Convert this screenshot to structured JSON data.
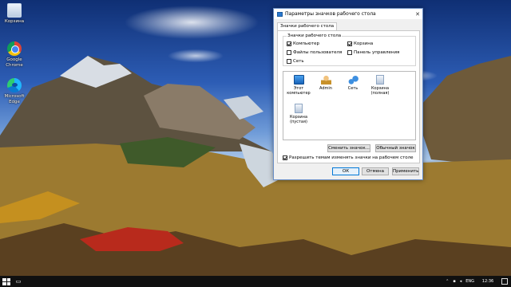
{
  "desktop": {
    "icons": [
      {
        "label": "Корзина",
        "icon": "recycle-bin-icon"
      },
      {
        "label": "Google Chrome",
        "icon": "chrome-icon"
      },
      {
        "label": "Microsoft Edge",
        "icon": "edge-icon"
      }
    ]
  },
  "dialog": {
    "title": "Параметры значков рабочего стола",
    "close_glyph": "✕",
    "tab": "Значки рабочего стола",
    "group_label": "Значки рабочего стола",
    "checkboxes": [
      {
        "label": "Компьютер",
        "checked": true
      },
      {
        "label": "Корзина",
        "checked": true
      },
      {
        "label": "Файлы пользователя",
        "checked": false
      },
      {
        "label": "Панель управления",
        "checked": false
      },
      {
        "label": "Сеть",
        "checked": false
      }
    ],
    "icon_list": [
      {
        "label": "Этот компьютер",
        "icon": "computer-icon"
      },
      {
        "label": "Admin",
        "icon": "user-folder-icon"
      },
      {
        "label": "Сеть",
        "icon": "network-icon"
      },
      {
        "label": "Корзина (полная)",
        "icon": "recycle-bin-full-icon"
      },
      {
        "label": "Корзина (пустая)",
        "icon": "recycle-bin-empty-icon"
      }
    ],
    "change_icon_button": "Сменить значок...",
    "default_icon_button": "Обычный значок",
    "allow_themes_label": "Разрешить темам изменять значки на рабочем столе",
    "allow_themes_checked": true,
    "ok_button": "ОК",
    "cancel_button": "Отмена",
    "apply_button": "Применить"
  },
  "taskbar": {
    "language": "ENG",
    "time": "12:36"
  }
}
